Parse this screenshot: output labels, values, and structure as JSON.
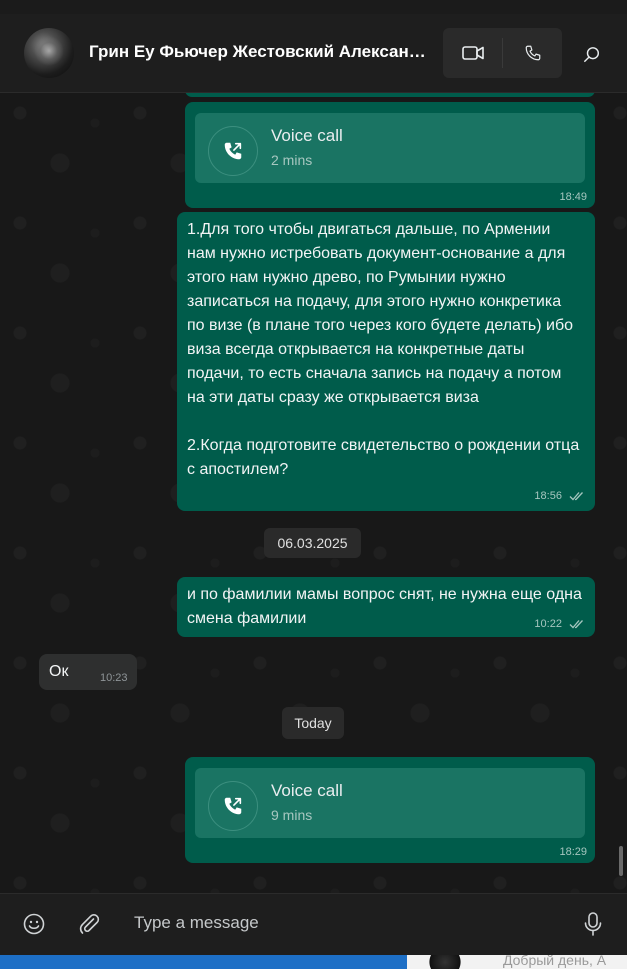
{
  "header": {
    "contact_name": "Грин Еу Фьючер Жестовский Александ...",
    "video_call_icon": "video-camera-icon",
    "voice_call_icon": "phone-icon",
    "search_icon": "search-icon"
  },
  "messages": [
    {
      "type": "voice_call",
      "direction": "outgoing",
      "title": "Voice call",
      "duration": "2 mins",
      "time": "18:49"
    },
    {
      "type": "text",
      "direction": "outgoing",
      "paragraphs": [
        "1.Для того чтобы двигаться дальше, по Армении нам нужно истребовать документ-основание а для этого нам нужно древо, по Румынии нужно записаться на подачу, для этого нужно конкретика по визе (в плане того через кого будете делать) ибо виза всегда открывается на конкретные даты подачи, то есть сначала запись на подачу а потом на эти даты сразу же открывается виза",
        "2.Когда подготовите свидетельство о рождении отца с апостилем?"
      ],
      "time": "18:56",
      "status": "read"
    },
    {
      "type": "date",
      "label": "06.03.2025"
    },
    {
      "type": "text",
      "direction": "outgoing",
      "text": "и по фамилии мамы вопрос снят, не нужна еще одна смена фамилии",
      "time": "10:22",
      "status": "read"
    },
    {
      "type": "text",
      "direction": "incoming",
      "text": "Ок",
      "time": "10:23"
    },
    {
      "type": "date",
      "label": "Today"
    },
    {
      "type": "voice_call",
      "direction": "outgoing",
      "title": "Voice call",
      "duration": "9 mins",
      "time": "18:29"
    }
  ],
  "composer": {
    "placeholder": "Type a message",
    "emoji_icon": "emoji-icon",
    "attach_icon": "paperclip-icon",
    "mic_icon": "microphone-icon"
  },
  "notification": {
    "preview": "Добрый день, А"
  },
  "colors": {
    "outgoing_bubble": "#005c4b",
    "incoming_bubble": "#2e2f2f",
    "voice_card": "#1a7463",
    "background": "#181818"
  }
}
